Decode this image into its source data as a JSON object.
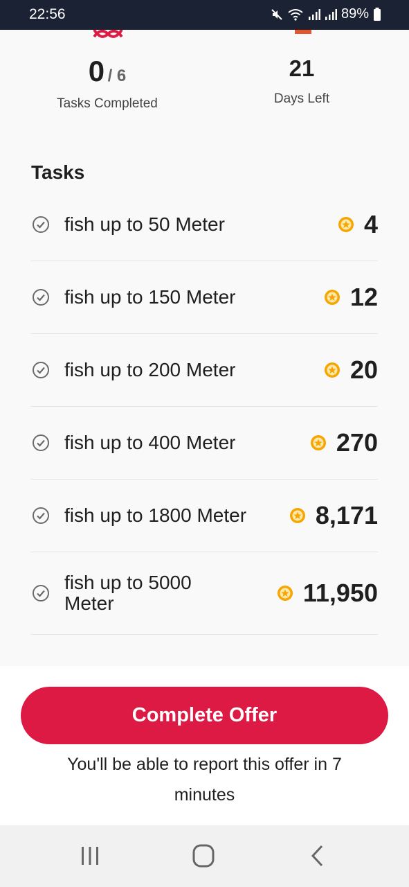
{
  "status_bar": {
    "time": "22:56",
    "battery": "89%",
    "icons": [
      "mute-icon",
      "wifi-icon",
      "signal-icon",
      "signal-icon",
      "battery-icon"
    ]
  },
  "stats": {
    "completed_value": "0",
    "completed_total": "/ 6",
    "completed_label": "Tasks Completed",
    "days_value": "21",
    "days_label": "Days Left"
  },
  "tasks": {
    "title": "Tasks",
    "items": [
      {
        "label": "fish up to 50 Meter",
        "points": "4"
      },
      {
        "label": "fish up to 150 Meter",
        "points": "12"
      },
      {
        "label": "fish up to 200 Meter",
        "points": "20"
      },
      {
        "label": "fish up to 400 Meter",
        "points": "270"
      },
      {
        "label": "fish up to 1800 Meter",
        "points": "8,171"
      },
      {
        "label": "fish up to 5000 Meter",
        "points": "11,950"
      }
    ]
  },
  "cta": {
    "label": "Complete Offer",
    "note": "You'll be able to report this offer in 7 minutes"
  },
  "colors": {
    "accent": "#dc1a44",
    "coin": "#f7a600",
    "status_bar": "#1b2233"
  },
  "nav_bar": {
    "icons": [
      "recent-apps-icon",
      "home-icon",
      "back-icon"
    ]
  }
}
